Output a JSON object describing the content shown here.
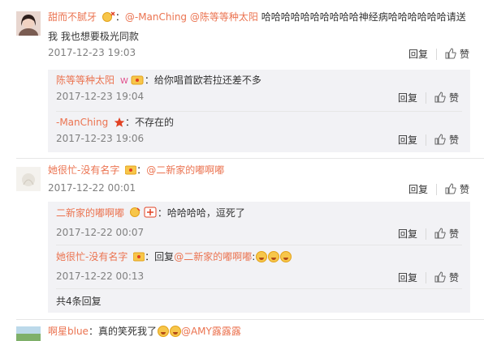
{
  "comments": [
    {
      "username": "甜而不腻牙",
      "mention_1": "@-ManChing",
      "mention_2": "@陈等等种太阳",
      "text_line1": " 哈哈哈哈哈哈哈哈哈哈神经病哈哈哈哈哈哈请送",
      "text_line2": "我 我也想要极光同款",
      "timestamp": "2017-12-23 19:03",
      "reply_label": "回复",
      "like_label": "赞",
      "replies": [
        {
          "username": "陈等等种太阳",
          "text": "：给你唱首欧若拉还差不多",
          "timestamp": "2017-12-23 19:04",
          "reply_label": "回复",
          "like_label": "赞"
        },
        {
          "username": "-ManChing",
          "text": "：不存在的",
          "timestamp": "2017-12-23 19:06",
          "reply_label": "回复",
          "like_label": "赞"
        }
      ]
    },
    {
      "username": "她很忙-没有名字",
      "mention": "@二新家的嘟啊嘟",
      "text": "：",
      "timestamp": "2017-12-22 00:01",
      "reply_label": "回复",
      "like_label": "赞",
      "replies": [
        {
          "username": "二新家的嘟啊嘟",
          "text": "：哈哈哈哈，逗死了",
          "timestamp": "2017-12-22 00:07",
          "reply_label": "回复",
          "like_label": "赞"
        },
        {
          "username": "她很忙-没有名字",
          "text_prefix": "：回复",
          "mention": "@二新家的嘟啊嘟",
          "text_suffix": ":",
          "timestamp": "2017-12-22 00:13",
          "reply_label": "回复",
          "like_label": "赞"
        }
      ],
      "more_replies": "共4条回复"
    },
    {
      "username": "啊星blue",
      "text": "：真的笑死我了",
      "mention": "@AMY露露露"
    }
  ],
  "colors": {
    "link": "#eb7350",
    "meta": "#808080",
    "reply_bg": "#f2f2f5"
  }
}
